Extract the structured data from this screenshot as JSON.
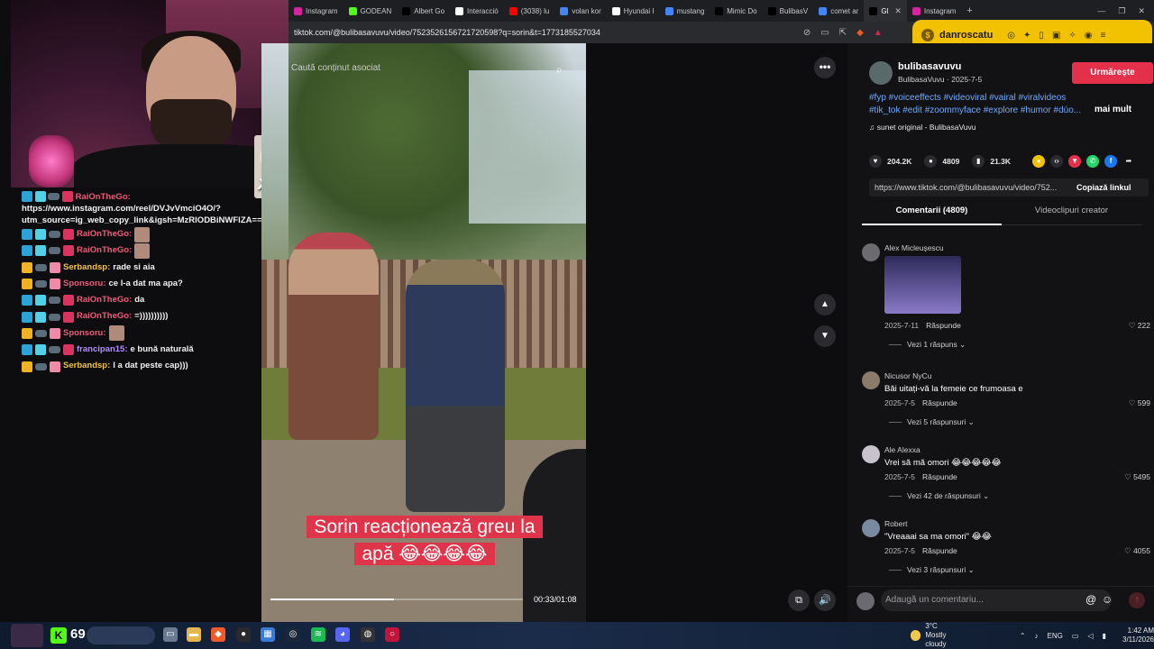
{
  "browser": {
    "tabs": [
      {
        "label": "Instagram",
        "color": "#d6249f"
      },
      {
        "label": "GODEAN",
        "color": "#53fc18"
      },
      {
        "label": "Albert Go",
        "color": "#000000"
      },
      {
        "label": "Interacció",
        "color": "#ffffff"
      },
      {
        "label": "(3038) lu",
        "color": "#ff0000"
      },
      {
        "label": "volan kor",
        "color": "#4285f4"
      },
      {
        "label": "Hyundai I",
        "color": "#ffffff"
      },
      {
        "label": "mustang",
        "color": "#4285f4"
      },
      {
        "label": "Mimic Do",
        "color": "#000000"
      },
      {
        "label": "BulibasV",
        "color": "#000000"
      },
      {
        "label": "comet ar",
        "color": "#4285f4"
      },
      {
        "label": "Gl",
        "color": "#000000",
        "active": true
      },
      {
        "label": "Instagram",
        "color": "#d6249f"
      }
    ],
    "url": "tiktok.com/@bulibasavuvu/video/7523526156721720598?q=sorin&t=1773185527034",
    "profile_name": "danroscatu"
  },
  "video": {
    "related_label": "Caută conținut asociat",
    "caption": "Sorin reacționează greu la apă 😂😂😂😂",
    "time": "00:33/01:08",
    "progress": 0.49
  },
  "overlay": {
    "multiplier": "x12"
  },
  "chat": [
    {
      "user": "RaiOnTheGo:",
      "user_class": "u-rai",
      "text": "https://www.instagram.com/reel/DVJvVmciO4O/?utm_source=ig_web_copy_link&igsh=MzRlODBiNWFlZA==",
      "badges": [
        "b-blue",
        "b-cyan",
        "b-glasses",
        "b-red"
      ],
      "wrap": true
    },
    {
      "user": "RaiOnTheGo:",
      "user_class": "u-rai",
      "text": "",
      "badges": [
        "b-blue",
        "b-cyan",
        "b-glasses",
        "b-red"
      ],
      "emote": true
    },
    {
      "user": "RaiOnTheGo:",
      "user_class": "u-rai",
      "text": "",
      "badges": [
        "b-blue",
        "b-cyan",
        "b-glasses",
        "b-red"
      ],
      "emote": true
    },
    {
      "user": "Serbandsp:",
      "user_class": "u-serb",
      "text": "rade si aia",
      "badges": [
        "b-crown",
        "b-glasses",
        "b-gift"
      ]
    },
    {
      "user": "Sponsoru:",
      "user_class": "u-spon",
      "text": "ce l-a dat ma apa?",
      "badges": [
        "b-crown",
        "b-glasses",
        "b-gift"
      ]
    },
    {
      "user": "RaiOnTheGo:",
      "user_class": "u-rai",
      "text": "da",
      "badges": [
        "b-blue",
        "b-cyan",
        "b-glasses",
        "b-red"
      ]
    },
    {
      "user": "RaiOnTheGo:",
      "user_class": "u-rai",
      "text": "=))))))))))",
      "badges": [
        "b-blue",
        "b-cyan",
        "b-glasses",
        "b-red"
      ]
    },
    {
      "user": "Sponsoru:",
      "user_class": "u-spon",
      "text": "",
      "badges": [
        "b-crown",
        "b-glasses",
        "b-gift"
      ],
      "emote": true
    },
    {
      "user": "francipan15:",
      "user_class": "u-fran",
      "text": "e bună naturală",
      "badges": [
        "b-blue",
        "b-cyan",
        "b-glasses",
        "b-red"
      ]
    },
    {
      "user": "Serbandsp:",
      "user_class": "u-serb",
      "text": "l a dat peste cap)))",
      "badges": [
        "b-crown",
        "b-glasses",
        "b-gift"
      ]
    }
  ],
  "post": {
    "author": "bulibasavuvu",
    "author_sub": "BulibasaVuvu · 2025-7-5",
    "follow_label": "Urmărește",
    "hashtags": "#fyp #voiceeffects #videoviral #vairal #viralvideos #tik_tok #edit #zoommyface #explore #humor #dúo...",
    "more_label": "mai mult",
    "sound": "♫  sunet original - BulibasaVuvu",
    "likes": "204.2K",
    "comments_count": "4809",
    "saves": "21.3K",
    "link_url": "https://www.tiktok.com/@bulibasavuvu/video/752...",
    "copy_label": "Copiază linkul",
    "tab_comments": "Comentarii (4809)",
    "tab_videos": "Videoclipuri creator"
  },
  "comments": [
    {
      "name": "Alex Micleușescu",
      "text": "",
      "date": "2025-7-11",
      "reply": "Răspunde",
      "likes": "♡ 222",
      "replies": "Vezi 1 răspuns ⌄",
      "gif": true
    },
    {
      "name": "Nicusor NyCu",
      "text": "Băi uitați-vă la femeie ce frumoasa e",
      "date": "2025-7-5",
      "reply": "Răspunde",
      "likes": "♡ 599",
      "replies": "Vezi 5 răspunsuri ⌄"
    },
    {
      "name": "Ale Alexxa",
      "text": "Vrei să mă omori 😂😂😂😂😂",
      "date": "2025-7-5",
      "reply": "Răspunde",
      "likes": "♡ 5495",
      "replies": "Vezi 42 de răspunsuri ⌄"
    },
    {
      "name": "Robert",
      "text": "\"Vreaaai sa ma omori\" 😂😂",
      "date": "2025-7-5",
      "reply": "Răspunde",
      "likes": "♡ 4055",
      "replies": "Vezi 3 răspunsuri ⌄"
    }
  ],
  "comment_bar": {
    "placeholder": "Adaugă un comentariu..."
  },
  "taskbar": {
    "count": "69",
    "weather_temp": "3°C",
    "weather_desc": "Mostly cloudy",
    "lang": "ENG",
    "time": "1:42 AM",
    "date": "3/11/2026"
  }
}
